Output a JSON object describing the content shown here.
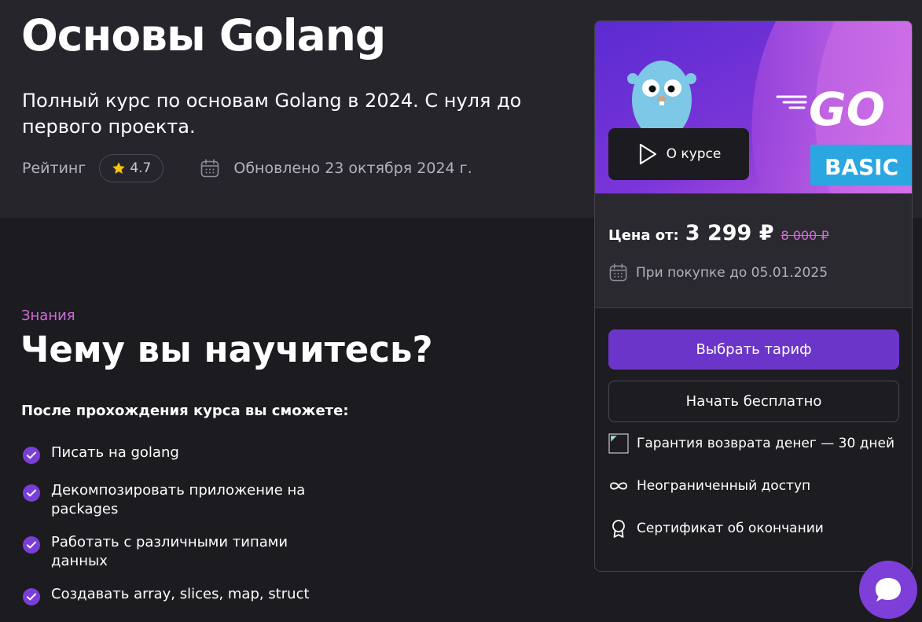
{
  "hero": {
    "title": "Основы Golang",
    "subtitle": "Полный курс по основам Golang в 2024. С нуля до первого проекта.",
    "rating_label": "Рейтинг",
    "rating_value": "4.7",
    "updated": "Обновлено 23 октября 2024 г."
  },
  "learn": {
    "eyebrow": "Знания",
    "heading": "Чему вы научитесь?",
    "lead": "После прохождения курса вы сможете:",
    "items": [
      "Писать на golang",
      "Декомпозировать приложение на packages",
      "Работать с различными типами данных",
      "Создавать array, slices, map, struct"
    ]
  },
  "card": {
    "promo_logo": "GO",
    "promo_badge": "BASIC",
    "video_label": "О курсе",
    "price_label": "Цена от:",
    "price_now": "3 299 ₽",
    "price_old": "8 000 ₽",
    "deadline": "При покупке до 05.01.2025",
    "choose_plan": "Выбрать тариф",
    "start_free": "Начать бесплатно",
    "perks": [
      {
        "icon": "money-back-image-icon",
        "label": "Гарантия возврата денег — 30 дней"
      },
      {
        "icon": "infinity-icon",
        "label": "Неограниченный доступ"
      },
      {
        "icon": "certificate-icon",
        "label": "Сертификат об окончании"
      }
    ]
  },
  "colors": {
    "page_bg": "#1c1b20",
    "hero_bg": "#26252c",
    "accent_purple": "#6c35c9",
    "accent_pink": "#d26bd9",
    "check_purple": "#7a3ed8",
    "badge_blue": "#2aa7e0"
  }
}
